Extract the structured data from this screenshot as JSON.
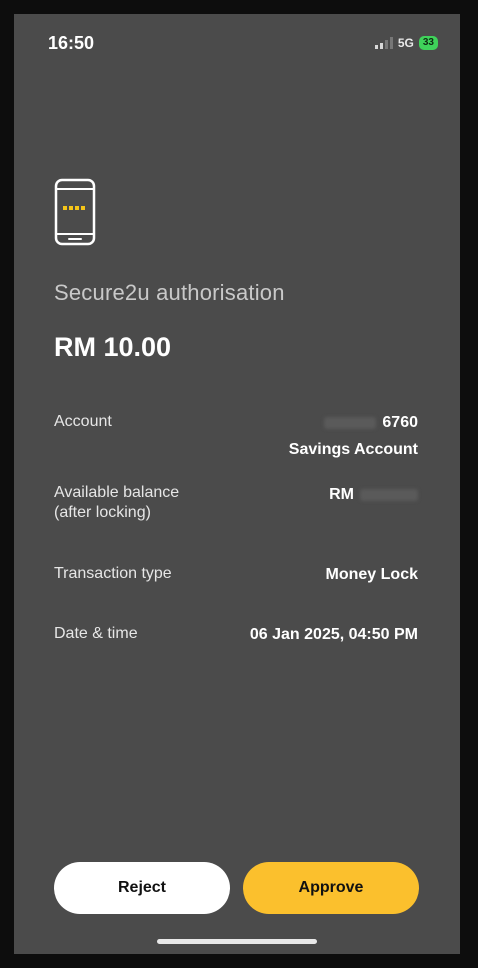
{
  "status_bar": {
    "time": "16:50",
    "network": "5G",
    "battery": "33"
  },
  "auth": {
    "title": "Secure2u authorisation",
    "amount": "RM 10.00"
  },
  "details": {
    "account_label": "Account",
    "account_number": "6760",
    "account_type": "Savings Account",
    "balance_label": "Available balance (after locking)",
    "balance_value": "RM",
    "type_label": "Transaction type",
    "type_value": "Money Lock",
    "datetime_label": "Date & time",
    "datetime_value": "06 Jan 2025, 04:50 PM"
  },
  "actions": {
    "reject": "Reject",
    "approve": "Approve"
  },
  "colors": {
    "background": "#4b4b4b",
    "approve": "#fbc02d",
    "battery": "#3fd25a"
  },
  "icons": {
    "phone": "phone-icon",
    "signal": "signal-icon",
    "battery": "battery-icon"
  }
}
